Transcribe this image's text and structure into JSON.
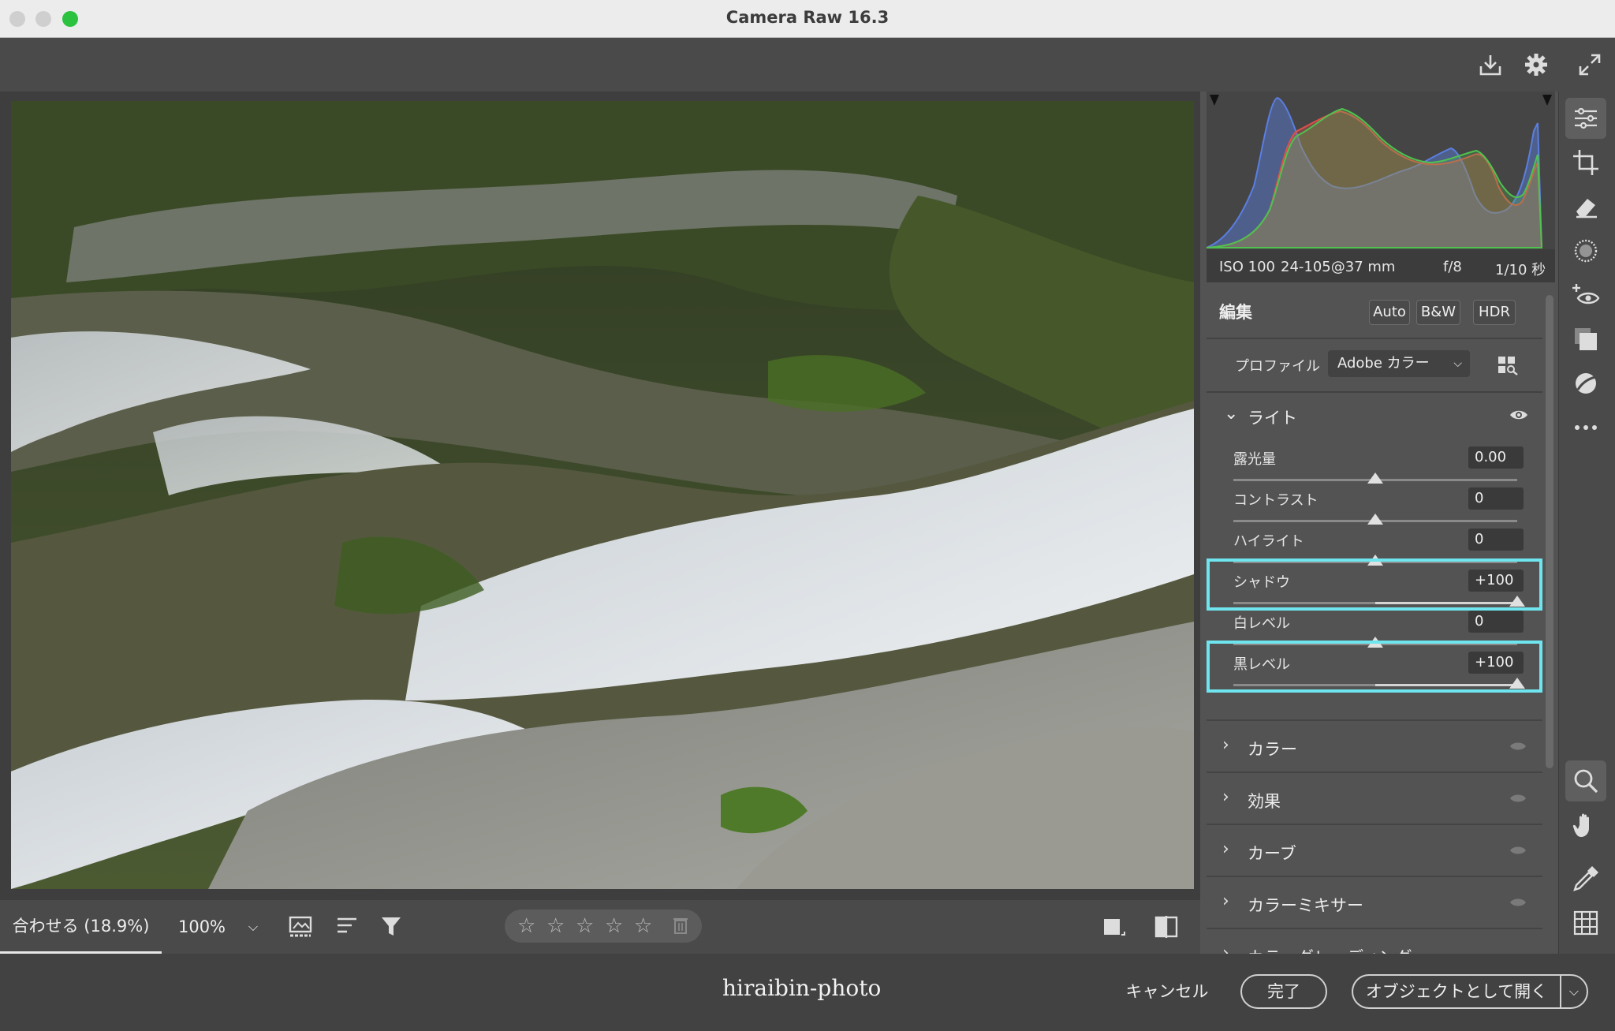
{
  "window": {
    "title": "Camera Raw 16.3"
  },
  "top_toolbar": {
    "icons": [
      "download-icon",
      "gear-icon",
      "fullscreen-icon"
    ]
  },
  "image_toolbar": {
    "fit_label": "合わせる (18.9%)",
    "zoom_label": "100%",
    "zoom_dropdown": "⌵",
    "rating_stars": [
      "☆",
      "☆",
      "☆",
      "☆",
      "☆"
    ],
    "icons": [
      "filmstrip-icon",
      "sort-icon",
      "filter-icon",
      "single-view-icon",
      "before-after-icon",
      "trash-icon"
    ]
  },
  "histogram": {
    "exif": {
      "iso": "ISO 100",
      "lens": "24-105@37 mm",
      "aperture": "f/8",
      "shutter": "1/10 秒"
    },
    "colors": {
      "blue": "#5a7fe0",
      "red": "#e0504a",
      "green": "#4fc24f"
    }
  },
  "edit_panel": {
    "title": "編集",
    "buttons": [
      "Auto",
      "B&W",
      "HDR"
    ],
    "profile_label": "プロファイル",
    "profile_value": "Adobe カラー",
    "light_section": {
      "label": "ライト",
      "sliders": [
        {
          "label": "露光量",
          "value": "0.00",
          "position": 0.5
        },
        {
          "label": "コントラスト",
          "value": "0",
          "position": 0.5
        },
        {
          "label": "ハイライト",
          "value": "0",
          "position": 0.5
        },
        {
          "label": "シャドウ",
          "value": "+100",
          "position": 1.0
        },
        {
          "label": "白レベル",
          "value": "0",
          "position": 0.5
        },
        {
          "label": "黒レベル",
          "value": "+100",
          "position": 1.0
        }
      ]
    },
    "sections": [
      {
        "label": "カラー"
      },
      {
        "label": "効果"
      },
      {
        "label": "カーブ"
      },
      {
        "label": "カラーミキサー"
      },
      {
        "label": "カラーグレーディング"
      }
    ],
    "highlight_color": "#6fe6ef"
  },
  "tool_strip": {
    "icons": [
      "edit-sliders-icon",
      "crop-icon",
      "eraser-icon",
      "mask-icon",
      "red-eye-icon",
      "snapshot-icon",
      "presets-icon",
      "more-icon",
      "zoom-icon",
      "hand-icon",
      "eyedropper-icon",
      "grid-icon"
    ]
  },
  "footer": {
    "watermark": "hiraibin-photo",
    "cancel_label": "キャンセル",
    "done_label": "完了",
    "open_label": "オブジェクトとして開く",
    "open_dropdown": "⌵"
  }
}
